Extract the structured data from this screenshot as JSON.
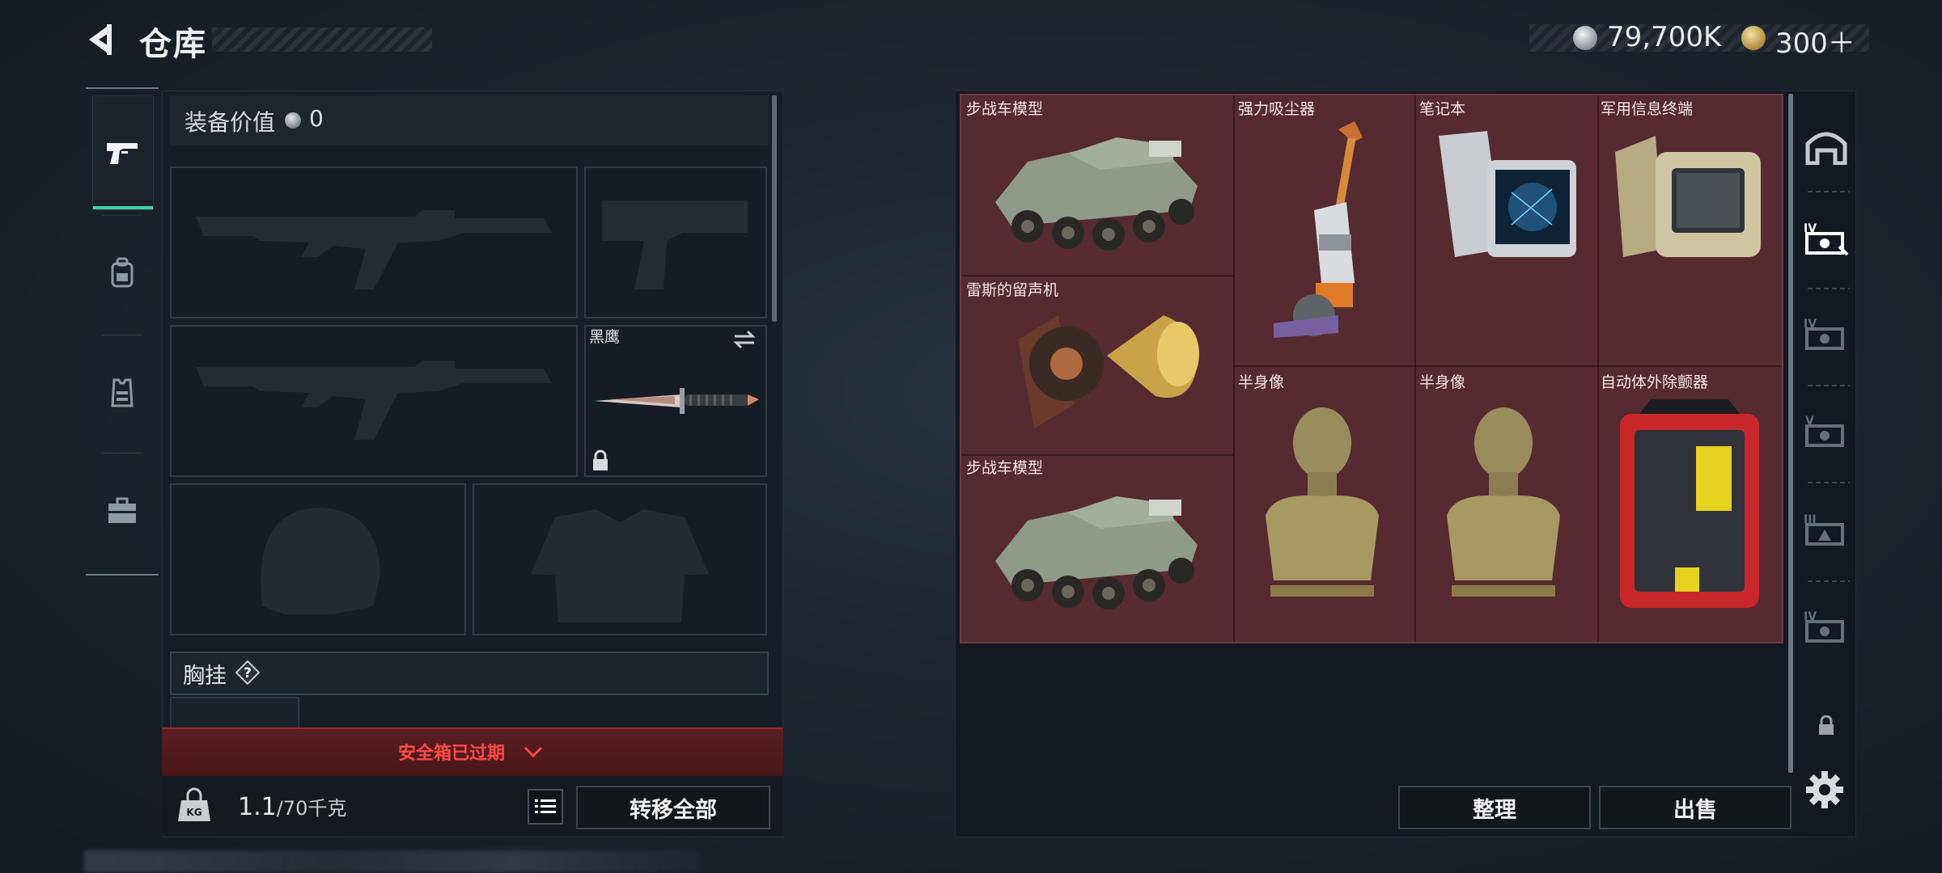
{
  "header": {
    "title": "仓库",
    "money": "79,700K",
    "gold": "300＋"
  },
  "equipment": {
    "value_label": "装备价值",
    "value_amount": "0",
    "melee_name": "黑鹰",
    "chest_label": "胸挂",
    "safe_box_status": "安全箱已过期",
    "weight_current": "1.1",
    "weight_max": "/70千克",
    "transfer_all": "转移全部"
  },
  "storage": {
    "items": [
      {
        "label": "步战车模型",
        "icon": "ifv-model"
      },
      {
        "label": "强力吸尘器",
        "icon": "vacuum-cleaner"
      },
      {
        "label": "笔记本",
        "icon": "laptop"
      },
      {
        "label": "军用信息终端",
        "icon": "military-terminal"
      },
      {
        "label": "雷斯的留声机",
        "icon": "gramophone"
      },
      {
        "label": "半身像",
        "icon": "bust-statue"
      },
      {
        "label": "半身像",
        "icon": "bust-statue"
      },
      {
        "label": "自动体外除颤器",
        "icon": "aed"
      },
      {
        "label": "步战车模型",
        "icon": "ifv-model"
      }
    ],
    "sort_label": "整理",
    "sell_label": "出售"
  },
  "colors": {
    "accent": "#3fd3a1",
    "warning": "#ff4a48",
    "storage_cell": "#552a31"
  }
}
